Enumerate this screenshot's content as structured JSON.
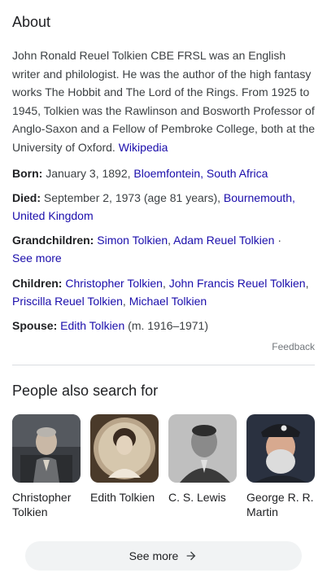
{
  "about": {
    "heading": "About",
    "description": "John Ronald Reuel Tolkien CBE FRSL was an English writer and philologist. He was the author of the high fantasy works The Hobbit and The Lord of the Rings. From 1925 to 1945, Tolkien was the Rawlinson and Bosworth Professor of Anglo-Saxon and a Fellow of Pembroke College, both at the University of Oxford.",
    "source_link": "Wikipedia"
  },
  "facts": {
    "born": {
      "label": "Born:",
      "date": "January 3, 1892, ",
      "place": "Bloemfontein, South Africa"
    },
    "died": {
      "label": "Died:",
      "date": "September 2, 1973 (age 81 years), ",
      "place": "Bournemouth, United Kingdom"
    },
    "grandchildren": {
      "label": "Grandchildren:",
      "names": [
        "Simon Tolkien",
        "Adam Reuel Tolkien"
      ],
      "separator": " · ",
      "see_more": "See more"
    },
    "children": {
      "label": "Children:",
      "names": [
        "Christopher Tolkien",
        "John Francis Reuel Tolkien",
        "Priscilla Reuel Tolkien",
        "Michael Tolkien"
      ]
    },
    "spouse": {
      "label": "Spouse:",
      "name": "Edith Tolkien",
      "years": " (m. 1916–1971)"
    }
  },
  "feedback": "Feedback",
  "pasf": {
    "title": "People also search for",
    "people": [
      {
        "name": "Christopher Tolkien"
      },
      {
        "name": "Edith Tolkien"
      },
      {
        "name": "C. S. Lewis"
      },
      {
        "name": "George R. R. Martin"
      }
    ]
  },
  "see_more_button": {
    "label": "See more",
    "icon": "arrow-right-icon"
  },
  "colors": {
    "link": "#1a0dab",
    "text": "#3c4043",
    "muted": "#70757a",
    "button_bg": "#f1f3f4"
  }
}
